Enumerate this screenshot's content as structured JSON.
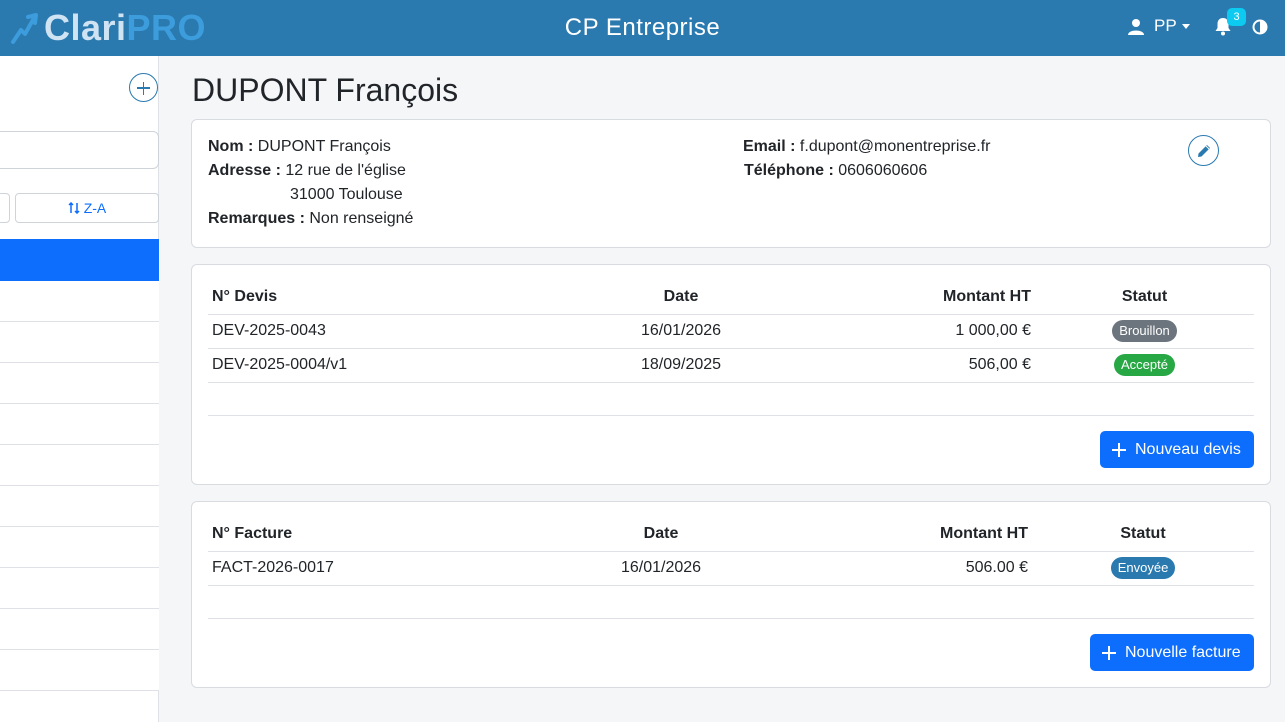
{
  "header": {
    "logo_part1": "Clari",
    "logo_part2": "PRO",
    "app_title": "CP Entreprise",
    "user_initials": "PP",
    "notification_count": "3"
  },
  "sidebar": {
    "search_placeholder": "",
    "sort_za_label": "Z-A",
    "client_count_visible": 11
  },
  "client": {
    "title": "DUPONT François",
    "nom_label": "Nom :",
    "nom": "DUPONT François",
    "adresse_label": "Adresse :",
    "adresse_line1": "12 rue de l'église",
    "adresse_line2": "31000 Toulouse",
    "remarques_label": "Remarques :",
    "remarques": "Non renseigné",
    "email_label": "Email :",
    "email": "f.dupont@monentreprise.fr",
    "telephone_label": "Téléphone :",
    "telephone": "0606060606"
  },
  "devis": {
    "headers": [
      "N° Devis",
      "Date",
      "Montant HT",
      "Statut"
    ],
    "rows": [
      {
        "numero": "DEV-2025-0043",
        "date": "16/01/2026",
        "montant": "1 000,00 €",
        "statut": "Brouillon",
        "statut_color": "#6c757d"
      },
      {
        "numero": "DEV-2025-0004/v1",
        "date": "18/09/2025",
        "montant": "506,00 €",
        "statut": "Accepté",
        "statut_color": "#28a745"
      }
    ],
    "add_label": "Nouveau devis"
  },
  "factures": {
    "headers": [
      "N° Facture",
      "Date",
      "Montant HT",
      "Statut"
    ],
    "rows": [
      {
        "numero": "FACT-2026-0017",
        "date": "16/01/2026",
        "montant": "506.00 €",
        "statut": "Envoyée",
        "statut_color": "#2a7ab0"
      }
    ],
    "add_label": "Nouvelle facture"
  },
  "colors": {
    "header_bg": "#2a7ab0",
    "primary": "#0d6efd"
  }
}
